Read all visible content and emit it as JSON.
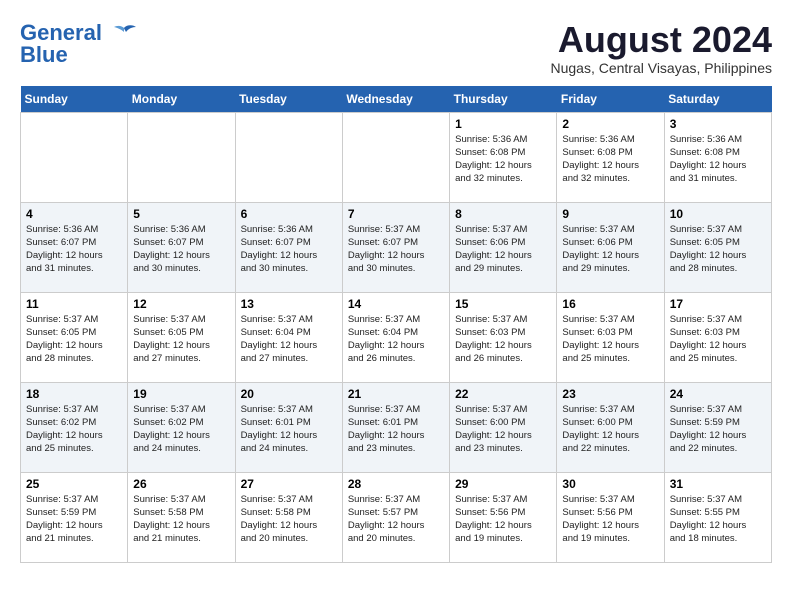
{
  "logo": {
    "line1": "General",
    "line2": "Blue"
  },
  "title": "August 2024",
  "location": "Nugas, Central Visayas, Philippines",
  "days_of_week": [
    "Sunday",
    "Monday",
    "Tuesday",
    "Wednesday",
    "Thursday",
    "Friday",
    "Saturday"
  ],
  "weeks": [
    [
      {
        "day": "",
        "info": ""
      },
      {
        "day": "",
        "info": ""
      },
      {
        "day": "",
        "info": ""
      },
      {
        "day": "",
        "info": ""
      },
      {
        "day": "1",
        "info": "Sunrise: 5:36 AM\nSunset: 6:08 PM\nDaylight: 12 hours\nand 32 minutes."
      },
      {
        "day": "2",
        "info": "Sunrise: 5:36 AM\nSunset: 6:08 PM\nDaylight: 12 hours\nand 32 minutes."
      },
      {
        "day": "3",
        "info": "Sunrise: 5:36 AM\nSunset: 6:08 PM\nDaylight: 12 hours\nand 31 minutes."
      }
    ],
    [
      {
        "day": "4",
        "info": "Sunrise: 5:36 AM\nSunset: 6:07 PM\nDaylight: 12 hours\nand 31 minutes."
      },
      {
        "day": "5",
        "info": "Sunrise: 5:36 AM\nSunset: 6:07 PM\nDaylight: 12 hours\nand 30 minutes."
      },
      {
        "day": "6",
        "info": "Sunrise: 5:36 AM\nSunset: 6:07 PM\nDaylight: 12 hours\nand 30 minutes."
      },
      {
        "day": "7",
        "info": "Sunrise: 5:37 AM\nSunset: 6:07 PM\nDaylight: 12 hours\nand 30 minutes."
      },
      {
        "day": "8",
        "info": "Sunrise: 5:37 AM\nSunset: 6:06 PM\nDaylight: 12 hours\nand 29 minutes."
      },
      {
        "day": "9",
        "info": "Sunrise: 5:37 AM\nSunset: 6:06 PM\nDaylight: 12 hours\nand 29 minutes."
      },
      {
        "day": "10",
        "info": "Sunrise: 5:37 AM\nSunset: 6:05 PM\nDaylight: 12 hours\nand 28 minutes."
      }
    ],
    [
      {
        "day": "11",
        "info": "Sunrise: 5:37 AM\nSunset: 6:05 PM\nDaylight: 12 hours\nand 28 minutes."
      },
      {
        "day": "12",
        "info": "Sunrise: 5:37 AM\nSunset: 6:05 PM\nDaylight: 12 hours\nand 27 minutes."
      },
      {
        "day": "13",
        "info": "Sunrise: 5:37 AM\nSunset: 6:04 PM\nDaylight: 12 hours\nand 27 minutes."
      },
      {
        "day": "14",
        "info": "Sunrise: 5:37 AM\nSunset: 6:04 PM\nDaylight: 12 hours\nand 26 minutes."
      },
      {
        "day": "15",
        "info": "Sunrise: 5:37 AM\nSunset: 6:03 PM\nDaylight: 12 hours\nand 26 minutes."
      },
      {
        "day": "16",
        "info": "Sunrise: 5:37 AM\nSunset: 6:03 PM\nDaylight: 12 hours\nand 25 minutes."
      },
      {
        "day": "17",
        "info": "Sunrise: 5:37 AM\nSunset: 6:03 PM\nDaylight: 12 hours\nand 25 minutes."
      }
    ],
    [
      {
        "day": "18",
        "info": "Sunrise: 5:37 AM\nSunset: 6:02 PM\nDaylight: 12 hours\nand 25 minutes."
      },
      {
        "day": "19",
        "info": "Sunrise: 5:37 AM\nSunset: 6:02 PM\nDaylight: 12 hours\nand 24 minutes."
      },
      {
        "day": "20",
        "info": "Sunrise: 5:37 AM\nSunset: 6:01 PM\nDaylight: 12 hours\nand 24 minutes."
      },
      {
        "day": "21",
        "info": "Sunrise: 5:37 AM\nSunset: 6:01 PM\nDaylight: 12 hours\nand 23 minutes."
      },
      {
        "day": "22",
        "info": "Sunrise: 5:37 AM\nSunset: 6:00 PM\nDaylight: 12 hours\nand 23 minutes."
      },
      {
        "day": "23",
        "info": "Sunrise: 5:37 AM\nSunset: 6:00 PM\nDaylight: 12 hours\nand 22 minutes."
      },
      {
        "day": "24",
        "info": "Sunrise: 5:37 AM\nSunset: 5:59 PM\nDaylight: 12 hours\nand 22 minutes."
      }
    ],
    [
      {
        "day": "25",
        "info": "Sunrise: 5:37 AM\nSunset: 5:59 PM\nDaylight: 12 hours\nand 21 minutes."
      },
      {
        "day": "26",
        "info": "Sunrise: 5:37 AM\nSunset: 5:58 PM\nDaylight: 12 hours\nand 21 minutes."
      },
      {
        "day": "27",
        "info": "Sunrise: 5:37 AM\nSunset: 5:58 PM\nDaylight: 12 hours\nand 20 minutes."
      },
      {
        "day": "28",
        "info": "Sunrise: 5:37 AM\nSunset: 5:57 PM\nDaylight: 12 hours\nand 20 minutes."
      },
      {
        "day": "29",
        "info": "Sunrise: 5:37 AM\nSunset: 5:56 PM\nDaylight: 12 hours\nand 19 minutes."
      },
      {
        "day": "30",
        "info": "Sunrise: 5:37 AM\nSunset: 5:56 PM\nDaylight: 12 hours\nand 19 minutes."
      },
      {
        "day": "31",
        "info": "Sunrise: 5:37 AM\nSunset: 5:55 PM\nDaylight: 12 hours\nand 18 minutes."
      }
    ]
  ]
}
